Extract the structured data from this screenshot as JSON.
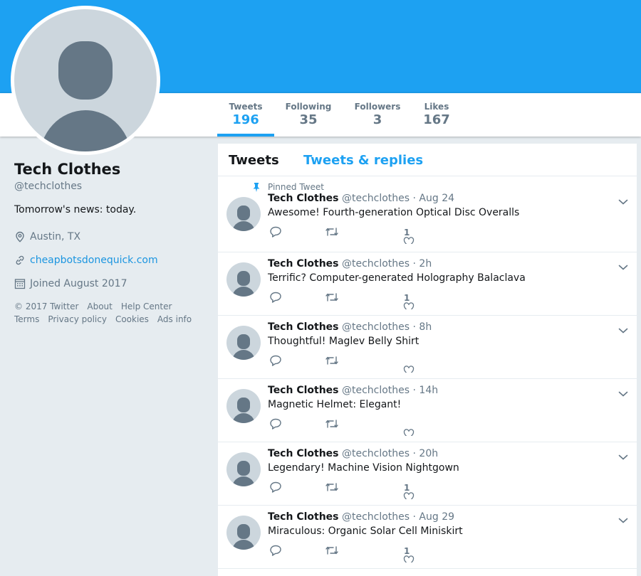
{
  "profile": {
    "name": "Tech Clothes",
    "handle": "@techclothes",
    "bio": "Tomorrow's news: today.",
    "location": "Austin, TX",
    "website": "cheapbotsdonequick.com",
    "joined": "Joined August 2017"
  },
  "stats": [
    {
      "label": "Tweets",
      "value": "196"
    },
    {
      "label": "Following",
      "value": "35"
    },
    {
      "label": "Followers",
      "value": "3"
    },
    {
      "label": "Likes",
      "value": "167"
    }
  ],
  "footer": [
    "© 2017 Twitter",
    "About",
    "Help Center",
    "Terms",
    "Privacy policy",
    "Cookies",
    "Ads info"
  ],
  "tabs": {
    "tweets": "Tweets",
    "replies": "Tweets & replies"
  },
  "pinned_label": "Pinned Tweet",
  "tweets": [
    {
      "name": "Tech Clothes",
      "handle": "@techclothes",
      "time": "· Aug 24",
      "text": "Awesome! Fourth-generation Optical Disc Overalls",
      "likes": "1"
    },
    {
      "name": "Tech Clothes",
      "handle": "@techclothes",
      "time": "· 2h",
      "text": "Terrific? Computer-generated Holography Balaclava",
      "likes": "1"
    },
    {
      "name": "Tech Clothes",
      "handle": "@techclothes",
      "time": "· 8h",
      "text": "Thoughtful! Maglev Belly Shirt",
      "likes": ""
    },
    {
      "name": "Tech Clothes",
      "handle": "@techclothes",
      "time": "· 14h",
      "text": "Magnetic Helmet: Elegant!",
      "likes": ""
    },
    {
      "name": "Tech Clothes",
      "handle": "@techclothes",
      "time": "· 20h",
      "text": "Legendary! Machine Vision Nightgown",
      "likes": "1"
    },
    {
      "name": "Tech Clothes",
      "handle": "@techclothes",
      "time": "· Aug 29",
      "text": "Miraculous: Organic Solar Cell Miniskirt",
      "likes": "1"
    }
  ],
  "icons": {
    "location": "location-pin-icon",
    "link": "link-icon",
    "calendar": "calendar-icon",
    "pin": "pin-icon",
    "reply": "reply-icon",
    "retweet": "retweet-icon",
    "like": "heart-icon",
    "caret": "chevron-down-icon"
  },
  "colors": {
    "brand": "#1da1f2",
    "link": "#1b95e0",
    "secondary_text": "#657786",
    "background": "#e6ecf0"
  }
}
